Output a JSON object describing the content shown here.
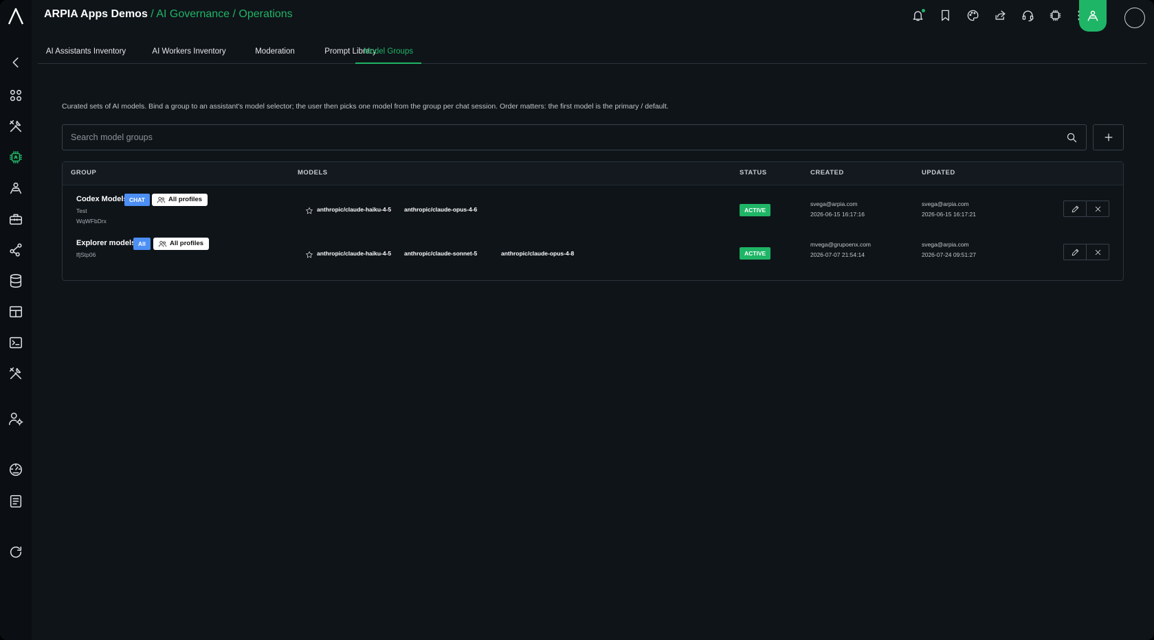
{
  "header": {
    "org": "ARPIA Apps Demos",
    "separator": "/",
    "crumb1": "AI Governance",
    "crumb2": "Operations"
  },
  "tabs": [
    {
      "label": "AI Assistants Inventory"
    },
    {
      "label": "AI Workers Inventory"
    },
    {
      "label": "Moderation"
    },
    {
      "label": "Prompt Library"
    },
    {
      "label": "Model Groups",
      "active": true
    }
  ],
  "description": "Curated sets of AI models. Bind a group to an assistant's model selector; the user then picks one model from the group per chat session. Order matters: the first model is the primary / default.",
  "search": {
    "placeholder": "Search model groups",
    "value": ""
  },
  "table": {
    "headers": {
      "group": "GROUP",
      "models": "MODELS",
      "status": "STATUS",
      "created": "CREATED",
      "updated": "UPDATED"
    },
    "rows": [
      {
        "name": "Codex Models",
        "type_badge": "CHAT",
        "profiles": "All profiles",
        "description": "Test",
        "id": "WqWFbDrx",
        "models": [
          "anthropic/claude-haiku-4-5",
          "anthropic/claude-opus-4-6"
        ],
        "status": "ACTIVE",
        "created_by": "svega@arpia.com",
        "created_at": "2026-06-15 16:17:16",
        "updated_by": "svega@arpia.com",
        "updated_at": "2026-06-15 16:17:21"
      },
      {
        "name": "Explorer models",
        "type_badge": "All",
        "profiles": "All profiles",
        "id": "lfjStp06",
        "models": [
          "anthropic/claude-haiku-4-5",
          "anthropic/claude-sonnet-5",
          "anthropic/claude-opus-4-8"
        ],
        "status": "ACTIVE",
        "created_by": "mvega@grupoenx.com",
        "created_at": "2026-07-07 21:54:14",
        "updated_by": "svega@arpia.com",
        "updated_at": "2026-07-24 09:51:27"
      }
    ]
  },
  "colors": {
    "accent": "#1fb566",
    "background": "#0f1419",
    "type_badge": "#4c8ff5"
  },
  "icons": {
    "sidebar": [
      "collapse-icon",
      "apps-icon",
      "tools-icon",
      "ai-chip-icon",
      "workers-icon",
      "toolbox-icon",
      "share-graph-icon",
      "database-icon",
      "table-icon",
      "terminal-icon",
      "tools-icon",
      "user-settings-icon",
      "dashboard-icon",
      "notebook-icon",
      "refresh-icon"
    ],
    "topbar": [
      "bell-icon",
      "bookmark-icon",
      "palette-icon",
      "share-icon",
      "support-icon",
      "chip-icon",
      "apps-grid-icon",
      "user-mode-icon"
    ]
  }
}
